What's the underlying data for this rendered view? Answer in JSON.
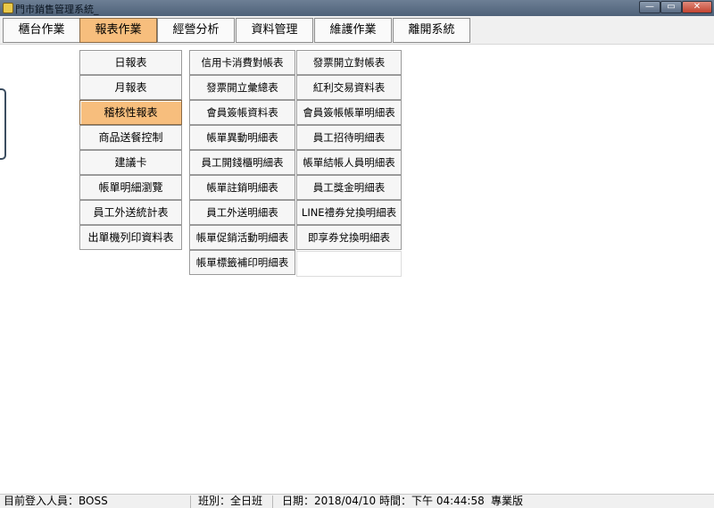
{
  "window": {
    "title": "門市銷售管理系統_",
    "min_glyph": "—",
    "max_glyph": "▭",
    "close_glyph": "✕"
  },
  "menubar": {
    "items": [
      "櫃台作業",
      "報表作業",
      "經營分析",
      "資料管理",
      "維護作業",
      "離開系統"
    ],
    "active_index": 1
  },
  "submenu": {
    "col1": [
      "日報表",
      "月報表",
      "稽核性報表",
      "商品送餐控制",
      "建議卡",
      "帳單明細瀏覽",
      "員工外送統計表",
      "出單機列印資料表"
    ],
    "col1_active_index": 2,
    "col2": [
      "信用卡消費對帳表",
      "發票開立彙總表",
      "會員簽帳資料表",
      "帳單異動明細表",
      "員工開錢櫃明細表",
      "帳單註銷明細表",
      "員工外送明細表",
      "帳單促銷活動明細表",
      "帳單標籤補印明細表"
    ],
    "col3": [
      "發票開立對帳表",
      "紅利交易資料表",
      "會員簽帳帳單明細表",
      "員工招待明細表",
      "帳單結帳人員明細表",
      "員工獎金明細表",
      "LINE禮券兌換明細表",
      "即享券兌換明細表"
    ]
  },
  "statusbar": {
    "login": "目前登入人員：BOSS",
    "shift": "班別：全日班",
    "date": "日期：2018/04/10",
    "time": "時間：下午 04:44:58",
    "edition": "專業版"
  },
  "colors": {
    "active_orange": "#f7be7d",
    "titlebar": "#4e6178",
    "close_button": "#c2432f"
  }
}
